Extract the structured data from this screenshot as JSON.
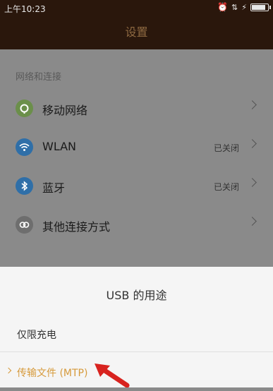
{
  "status": {
    "time": "上午10:23",
    "battery_level": 0.9
  },
  "header": {
    "title": "设置"
  },
  "section": {
    "label": "网络和连接"
  },
  "rows": [
    {
      "label": "移动网络",
      "state": "",
      "icon": "mobile-network-icon",
      "color": "#6b8f4a"
    },
    {
      "label": "WLAN",
      "state": "已关闭",
      "icon": "wifi-icon",
      "color": "#2f6fa8"
    },
    {
      "label": "蓝牙",
      "state": "已关闭",
      "icon": "bluetooth-icon",
      "color": "#2f6fa8"
    },
    {
      "label": "其他连接方式",
      "state": "",
      "icon": "link-icon",
      "color": "#6e6e6e"
    }
  ],
  "dialog": {
    "title": "USB 的用途",
    "options": [
      {
        "label": "仅限充电"
      },
      {
        "label": "传输文件 (MTP)"
      }
    ],
    "selected_index": 1,
    "accent": "#d69a3b"
  }
}
